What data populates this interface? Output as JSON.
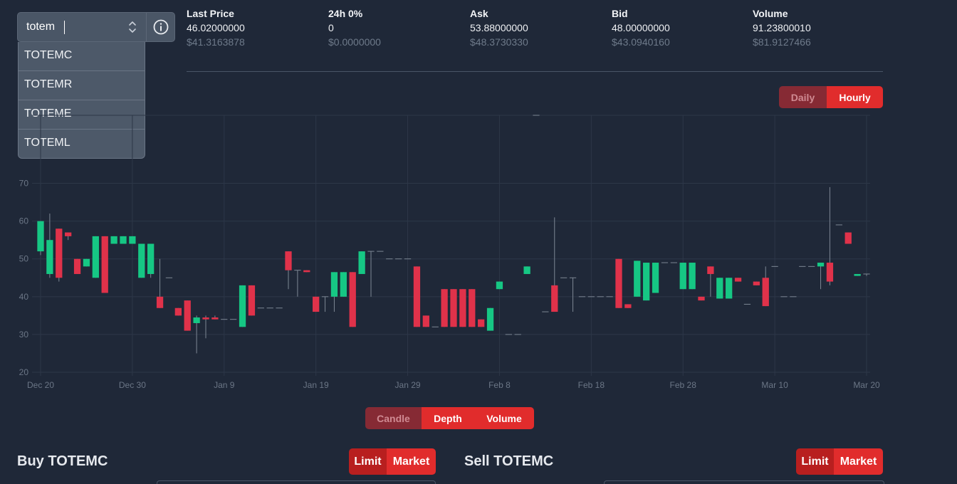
{
  "search": {
    "value": "totem",
    "placeholder": ""
  },
  "dropdown": {
    "items": [
      "TOTEMC",
      "TOTEMR",
      "TOTEME",
      "TOTEML"
    ]
  },
  "stats": [
    {
      "label": "Last Price",
      "value": "46.02000000",
      "usd": "$41.3163878"
    },
    {
      "label": "24h 0%",
      "value": "0",
      "usd": "$0.0000000"
    },
    {
      "label": "Ask",
      "value": "53.88000000",
      "usd": "$48.3730330"
    },
    {
      "label": "Bid",
      "value": "48.00000000",
      "usd": "$43.0940160"
    },
    {
      "label": "Volume",
      "value": "91.23800010",
      "usd": "$81.9127466"
    }
  ],
  "interval": {
    "daily": "Daily",
    "hourly": "Hourly",
    "selected": "Hourly"
  },
  "chart_tabs": {
    "candle": "Candle",
    "depth": "Depth",
    "volume": "Volume",
    "selected": "Candle"
  },
  "buy": {
    "title": "Buy TOTEMC",
    "limit": "Limit",
    "market": "Market"
  },
  "sell": {
    "title": "Sell TOTEMC",
    "limit": "Limit",
    "market": "Market"
  },
  "colors": {
    "up": "#16c784",
    "down": "#e0324a",
    "accent": "#e12c2c"
  },
  "chart_data": {
    "type": "candlestick",
    "x_ticks": [
      "Dec 20",
      "Dec 30",
      "Jan 9",
      "Jan 19",
      "Jan 29",
      "Feb 8",
      "Feb 18",
      "Feb 28",
      "Mar 10",
      "Mar 20"
    ],
    "y_ticks": [
      20,
      30,
      40,
      50,
      60,
      70
    ],
    "ylim": [
      20,
      88
    ],
    "x_start": "Dec 20",
    "x_end": "Mar 20",
    "candles": [
      [
        "Dec 20",
        52,
        60,
        51,
        60
      ],
      [
        "Dec 21",
        46,
        55,
        45,
        62
      ],
      [
        "Dec 22",
        58,
        45,
        44,
        58
      ],
      [
        "Dec 23",
        57,
        56,
        55,
        57
      ],
      [
        "Dec 24",
        50,
        46,
        46,
        50
      ],
      [
        "Dec 25",
        48,
        50,
        48,
        50
      ],
      [
        "Dec 26",
        45,
        56,
        45,
        56
      ],
      [
        "Dec 27",
        56,
        41,
        41,
        56
      ],
      [
        "Dec 28",
        54,
        56,
        54,
        56
      ],
      [
        "Dec 29",
        54,
        56,
        54,
        56
      ],
      [
        "Dec 30",
        54,
        56,
        54,
        56
      ],
      [
        "Dec 31",
        45,
        54,
        45,
        54
      ],
      [
        "Jan 1",
        46,
        54,
        45,
        54
      ],
      [
        "Jan 2",
        40,
        37,
        37,
        50
      ],
      [
        "Jan 3",
        45,
        45,
        45,
        45
      ],
      [
        "Jan 4",
        37,
        35,
        35,
        37
      ],
      [
        "Jan 5",
        39,
        31,
        31,
        39
      ],
      [
        "Jan 6",
        33,
        34.5,
        25,
        35
      ],
      [
        "Jan 7",
        34.5,
        34,
        29,
        35
      ],
      [
        "Jan 8",
        34.5,
        34,
        34,
        35
      ],
      [
        "Jan 9",
        34,
        34,
        34,
        34
      ],
      [
        "Jan 10",
        34,
        34,
        34,
        34
      ],
      [
        "Jan 11",
        32,
        43,
        32,
        43
      ],
      [
        "Jan 12",
        43,
        35,
        35,
        43
      ],
      [
        "Jan 13",
        37,
        37,
        37,
        37
      ],
      [
        "Jan 14",
        37,
        37,
        37,
        37
      ],
      [
        "Jan 15",
        37,
        37,
        37,
        37
      ],
      [
        "Jan 16",
        52,
        47,
        42,
        52
      ],
      [
        "Jan 17",
        47,
        47,
        40,
        47
      ],
      [
        "Jan 18",
        47,
        46.5,
        46.5,
        47
      ],
      [
        "Jan 19",
        40,
        36,
        36,
        40
      ],
      [
        "Jan 20",
        40,
        40,
        36,
        40
      ],
      [
        "Jan 21",
        40,
        46.5,
        36,
        46.5
      ],
      [
        "Jan 22",
        40,
        46.5,
        40,
        46.5
      ],
      [
        "Jan 23",
        46.5,
        32,
        32,
        46.5
      ],
      [
        "Jan 24",
        46,
        52,
        46,
        52
      ],
      [
        "Jan 25",
        52,
        52,
        40,
        52
      ],
      [
        "Jan 26",
        52,
        52,
        52,
        52
      ],
      [
        "Jan 27",
        50,
        50,
        50,
        50
      ],
      [
        "Jan 28",
        50,
        50,
        50,
        50
      ],
      [
        "Jan 29",
        50,
        50,
        50,
        50
      ],
      [
        "Jan 30",
        48,
        32,
        32,
        48
      ],
      [
        "Jan 31",
        35,
        32,
        32,
        35
      ],
      [
        "Feb 1",
        32,
        32,
        32,
        32
      ],
      [
        "Feb 2",
        42,
        32,
        32,
        42
      ],
      [
        "Feb 3",
        42,
        32,
        32,
        42
      ],
      [
        "Feb 4",
        42,
        32,
        32,
        42
      ],
      [
        "Feb 5",
        42,
        32,
        32,
        42
      ],
      [
        "Feb 6",
        34,
        32,
        32,
        34
      ],
      [
        "Feb 7",
        31,
        37,
        31,
        37
      ],
      [
        "Feb 8",
        42,
        44,
        42,
        44
      ],
      [
        "Feb 9",
        30,
        30,
        30,
        30
      ],
      [
        "Feb 10",
        30,
        30,
        30,
        30
      ],
      [
        "Feb 11",
        46,
        48,
        46,
        48
      ],
      [
        "Feb 12",
        88,
        88,
        88,
        88
      ],
      [
        "Feb 13",
        36,
        36,
        36,
        36
      ],
      [
        "Feb 14",
        43,
        36,
        36,
        61
      ],
      [
        "Feb 15",
        45,
        45,
        45,
        45
      ],
      [
        "Feb 16",
        45,
        45,
        36,
        45
      ],
      [
        "Feb 17",
        40,
        40,
        40,
        40
      ],
      [
        "Feb 18",
        40,
        40,
        40,
        40
      ],
      [
        "Feb 19",
        40,
        40,
        40,
        40
      ],
      [
        "Feb 20",
        40,
        40,
        40,
        40
      ],
      [
        "Feb 21",
        50,
        37,
        37,
        50
      ],
      [
        "Feb 22",
        38,
        37,
        37,
        38
      ],
      [
        "Feb 23",
        40,
        49.5,
        40,
        49.5
      ],
      [
        "Feb 24",
        39,
        49,
        39,
        49
      ],
      [
        "Feb 25",
        41,
        49,
        41,
        49
      ],
      [
        "Feb 26",
        49,
        49,
        49,
        49
      ],
      [
        "Feb 27",
        49,
        49,
        49,
        49
      ],
      [
        "Feb 28",
        42,
        49,
        42,
        49
      ],
      [
        "Mar 1",
        42,
        49,
        42,
        49
      ],
      [
        "Mar 2",
        40,
        39,
        39,
        40
      ],
      [
        "Mar 3",
        48,
        46,
        40,
        48
      ],
      [
        "Mar 4",
        39.5,
        45,
        39.5,
        45
      ],
      [
        "Mar 5",
        39.5,
        45,
        39.5,
        45
      ],
      [
        "Mar 6",
        45,
        44,
        44,
        45
      ],
      [
        "Mar 7",
        38,
        38,
        38,
        38
      ],
      [
        "Mar 8",
        44,
        43,
        43,
        44
      ],
      [
        "Mar 9",
        45,
        37.5,
        37.5,
        48
      ],
      [
        "Mar 10",
        48,
        48,
        48,
        48
      ],
      [
        "Mar 11",
        40,
        40,
        40,
        40
      ],
      [
        "Mar 12",
        40,
        40,
        40,
        40
      ],
      [
        "Mar 13",
        48,
        48,
        48,
        48
      ],
      [
        "Mar 14",
        48,
        48,
        48,
        48
      ],
      [
        "Mar 15",
        48,
        49,
        42,
        49
      ],
      [
        "Mar 16",
        49,
        44,
        43,
        69
      ],
      [
        "Mar 17",
        59,
        59,
        59,
        59
      ],
      [
        "Mar 18",
        57,
        54,
        54,
        57
      ],
      [
        "Mar 19",
        45.5,
        46,
        45.5,
        46
      ],
      [
        "Mar 20",
        46,
        46,
        45.5,
        46
      ]
    ]
  }
}
